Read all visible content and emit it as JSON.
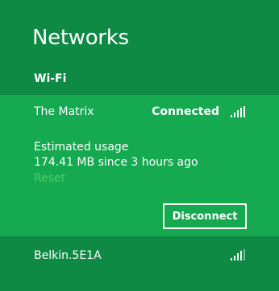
{
  "panel": {
    "title": "Networks"
  },
  "section": {
    "label": "Wi-Fi"
  },
  "networks": [
    {
      "name": "The Matrix",
      "status": "Connected",
      "signal_bars": 5,
      "usage_label": "Estimated usage",
      "usage_value": "174.41 MB since 3 hours ago",
      "reset_label": "Reset",
      "action_label": "Disconnect"
    },
    {
      "name": "Belkin.5E1A",
      "signal_bars": 4
    }
  ],
  "colors": {
    "background": "#0e8a44",
    "expanded_row": "#15a950",
    "link": "#4cd06a",
    "text": "#ffffff"
  },
  "icons": [
    "wifi-signal-icon"
  ]
}
